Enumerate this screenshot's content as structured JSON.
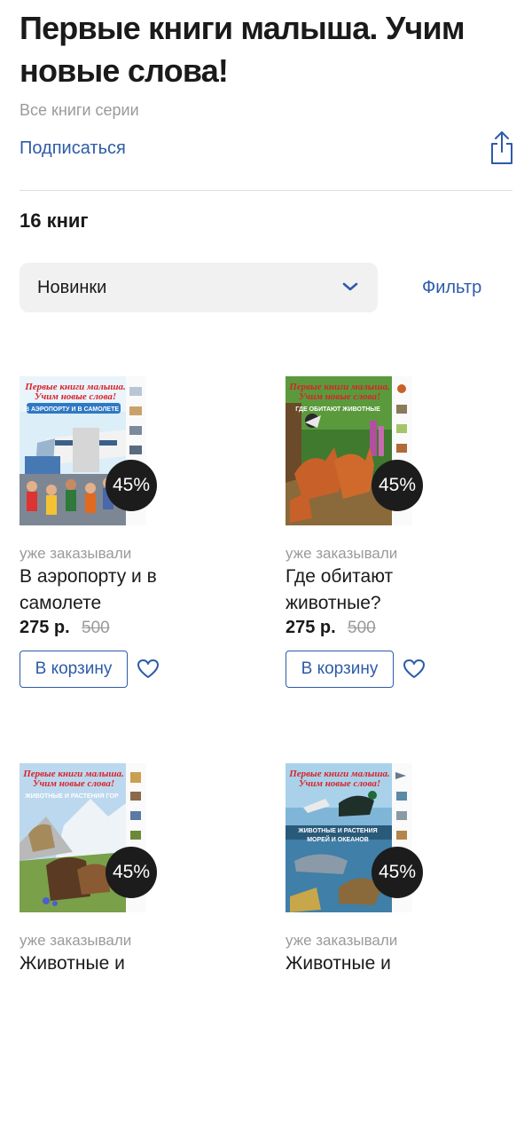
{
  "header": {
    "title": "Первые книги малыша. Учим новые слова!",
    "subtitle": "Все книги серии",
    "subscribe_label": "Подписаться",
    "share_icon": "share-icon"
  },
  "catalog": {
    "count_label": "16 книг",
    "sort_label": "Новинки",
    "filter_label": "Фильтр"
  },
  "books": [
    {
      "title": "В аэропорту и в самолете",
      "status": "уже заказывали",
      "discount": "45%",
      "price": "275 р.",
      "old_price": "500",
      "cart_label": "В корзину",
      "cover_series": "Первые книги малыша. Учим новые слова!",
      "cover_title": "В АЭРОПОРТУ И В САМОЛЕТЕ"
    },
    {
      "title": "Где обитают животные?",
      "status": "уже заказывали",
      "discount": "45%",
      "price": "275 р.",
      "old_price": "500",
      "cart_label": "В корзину",
      "cover_series": "Первые книги малыша. Учим новые слова!",
      "cover_title": "ГДЕ ОБИТАЮТ ЖИВОТНЫЕ"
    },
    {
      "title": "Животные и",
      "status": "уже заказывали",
      "discount": "45%",
      "cover_series": "Первые книги малыша. Учим новые слова!",
      "cover_title": "ЖИВОТНЫЕ И РАСТЕНИЯ ГОР"
    },
    {
      "title": "Животные и",
      "status": "уже заказывали",
      "discount": "45%",
      "cover_series": "Первые книги малыша. Учим новые слова!",
      "cover_title": "ЖИВОТНЫЕ И РАСТЕНИЯ МОРЕЙ И ОКЕАНОВ"
    }
  ],
  "colors": {
    "accent": "#2d5ba8",
    "muted": "#9a9a9a",
    "badge_bg": "#1c1c1c",
    "sort_bg": "#f1f1f1"
  }
}
